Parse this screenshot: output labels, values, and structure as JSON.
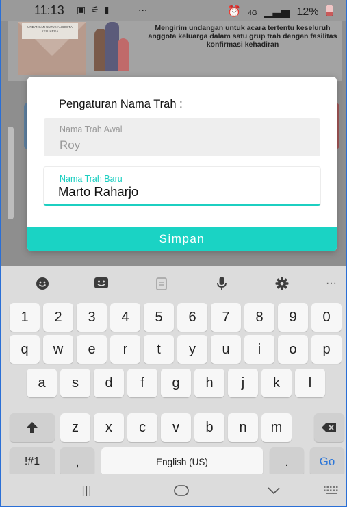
{
  "status_bar": {
    "time": "11:13",
    "network": "4G",
    "battery": "12%",
    "more_icon": "..."
  },
  "banner": {
    "text": "Mengirim undangan untuk acara  tertentu keseluruh anggota keluarga dalam satu grup trah dengan fasilitas konfirmasi kehadiran",
    "card_text": "UNDANGAN UNTUK ANGGOTA KELUARGA"
  },
  "dialog": {
    "title": "Pengaturan Nama Trah :",
    "old_field": {
      "label": "Nama Trah Awal",
      "value": "Roy"
    },
    "new_field": {
      "label": "Nama Trah Baru",
      "value": "Marto Raharjo"
    },
    "save_label": "Simpan",
    "accent_color": "#1ad3c4"
  },
  "keyboard": {
    "toolbar_icons": [
      "emoji-icon",
      "sticker-icon",
      "clipboard-icon",
      "mic-icon",
      "settings-icon",
      "more-icon"
    ],
    "number_row": [
      "1",
      "2",
      "3",
      "4",
      "5",
      "6",
      "7",
      "8",
      "9",
      "0"
    ],
    "row1": [
      "q",
      "w",
      "e",
      "r",
      "t",
      "y",
      "u",
      "i",
      "o",
      "p"
    ],
    "row2": [
      "a",
      "s",
      "d",
      "f",
      "g",
      "h",
      "j",
      "k",
      "l"
    ],
    "row3": [
      "z",
      "x",
      "c",
      "v",
      "b",
      "n",
      "m"
    ],
    "symbols_label": "!#1",
    "comma_label": ",",
    "space_label": "English (US)",
    "period_label": ".",
    "go_label": "Go"
  },
  "nav_bar": {
    "recents_label": "|||"
  }
}
